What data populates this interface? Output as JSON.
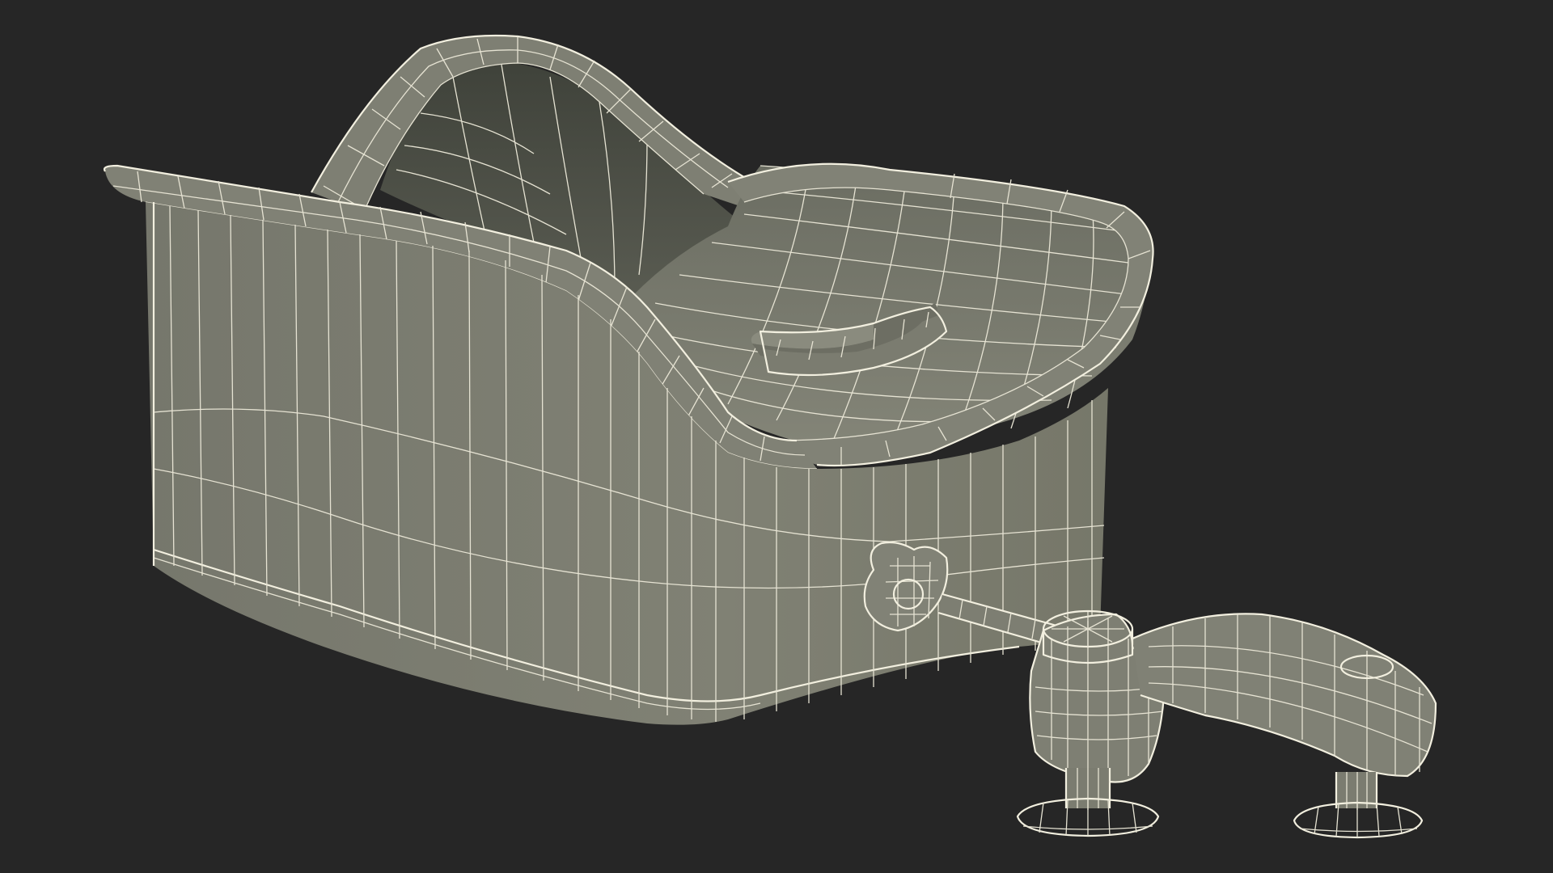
{
  "scene": {
    "subject": "wireframe-baby-bath-seat",
    "background_color": "#262626",
    "surface_color": "#7c7d72",
    "inner_shadow_color": "#45473f",
    "wire_color": "#e6e3d3"
  }
}
